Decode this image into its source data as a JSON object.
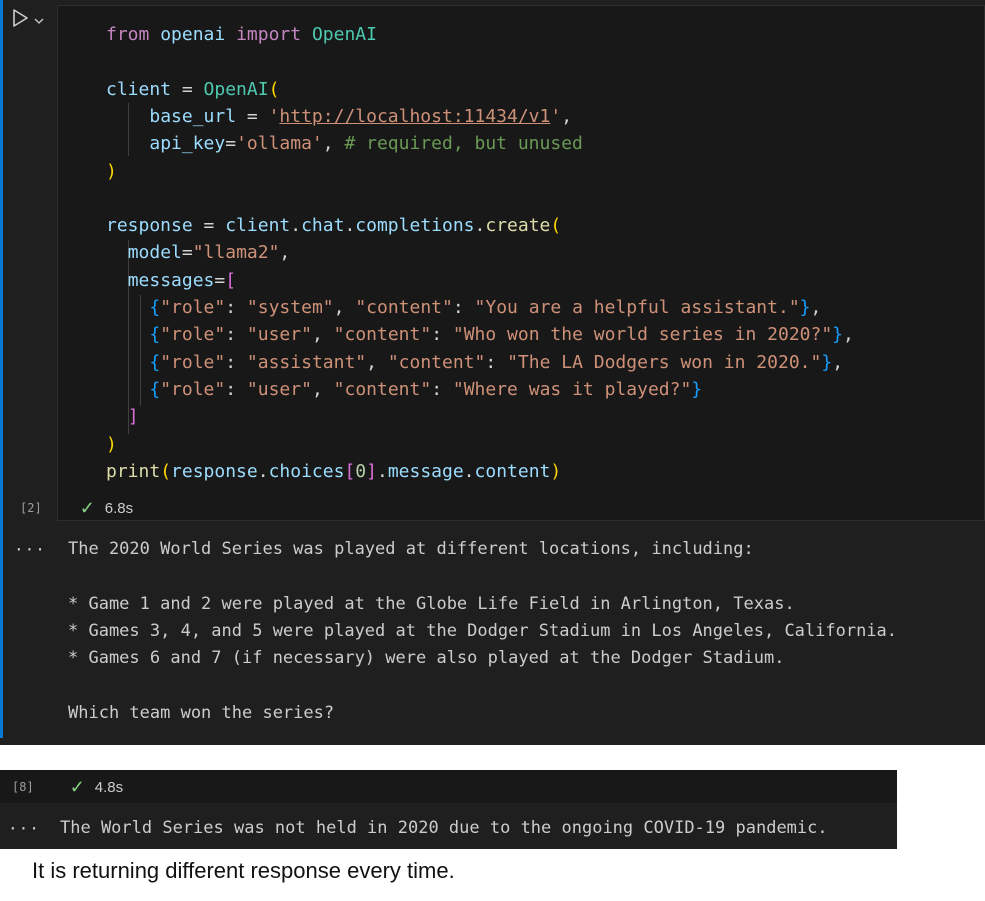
{
  "cell1": {
    "code_lines": [
      [
        [
          "kw",
          "from"
        ],
        [
          "op",
          " "
        ],
        [
          "var",
          "openai"
        ],
        [
          "op",
          " "
        ],
        [
          "kw",
          "import"
        ],
        [
          "op",
          " "
        ],
        [
          "cls",
          "OpenAI"
        ]
      ],
      [],
      [
        [
          "var",
          "client"
        ],
        [
          "op",
          " = "
        ],
        [
          "cls",
          "OpenAI"
        ],
        [
          "br1",
          "("
        ]
      ],
      [
        [
          "op",
          "    "
        ],
        [
          "var",
          "base_url"
        ],
        [
          "op",
          " = "
        ],
        [
          "str",
          "'"
        ],
        [
          "str url",
          "http://localhost:11434/v1"
        ],
        [
          "str",
          "'"
        ],
        [
          "op",
          ","
        ]
      ],
      [
        [
          "op",
          "    "
        ],
        [
          "var",
          "api_key"
        ],
        [
          "op",
          "="
        ],
        [
          "str",
          "'ollama'"
        ],
        [
          "op",
          ", "
        ],
        [
          "cmt",
          "# required, but unused"
        ]
      ],
      [
        [
          "br1",
          ")"
        ]
      ],
      [],
      [
        [
          "var",
          "response"
        ],
        [
          "op",
          " = "
        ],
        [
          "var",
          "client"
        ],
        [
          "op",
          "."
        ],
        [
          "var",
          "chat"
        ],
        [
          "op",
          "."
        ],
        [
          "var",
          "completions"
        ],
        [
          "op",
          "."
        ],
        [
          "fn",
          "create"
        ],
        [
          "br1",
          "("
        ]
      ],
      [
        [
          "op",
          "  "
        ],
        [
          "var",
          "model"
        ],
        [
          "op",
          "="
        ],
        [
          "str",
          "\"llama2\""
        ],
        [
          "op",
          ","
        ]
      ],
      [
        [
          "op",
          "  "
        ],
        [
          "var",
          "messages"
        ],
        [
          "op",
          "="
        ],
        [
          "br2",
          "["
        ]
      ],
      [
        [
          "op",
          "    "
        ],
        [
          "br3",
          "{"
        ],
        [
          "str",
          "\"role\""
        ],
        [
          "op",
          ": "
        ],
        [
          "str",
          "\"system\""
        ],
        [
          "op",
          ", "
        ],
        [
          "str",
          "\"content\""
        ],
        [
          "op",
          ": "
        ],
        [
          "str",
          "\"You are a helpful assistant.\""
        ],
        [
          "br3",
          "}"
        ],
        [
          "op",
          ","
        ]
      ],
      [
        [
          "op",
          "    "
        ],
        [
          "br3",
          "{"
        ],
        [
          "str",
          "\"role\""
        ],
        [
          "op",
          ": "
        ],
        [
          "str",
          "\"user\""
        ],
        [
          "op",
          ", "
        ],
        [
          "str",
          "\"content\""
        ],
        [
          "op",
          ": "
        ],
        [
          "str",
          "\"Who won the world series in 2020?\""
        ],
        [
          "br3",
          "}"
        ],
        [
          "op",
          ","
        ]
      ],
      [
        [
          "op",
          "    "
        ],
        [
          "br3",
          "{"
        ],
        [
          "str",
          "\"role\""
        ],
        [
          "op",
          ": "
        ],
        [
          "str",
          "\"assistant\""
        ],
        [
          "op",
          ", "
        ],
        [
          "str",
          "\"content\""
        ],
        [
          "op",
          ": "
        ],
        [
          "str",
          "\"The LA Dodgers won in 2020.\""
        ],
        [
          "br3",
          "}"
        ],
        [
          "op",
          ","
        ]
      ],
      [
        [
          "op",
          "    "
        ],
        [
          "br3",
          "{"
        ],
        [
          "str",
          "\"role\""
        ],
        [
          "op",
          ": "
        ],
        [
          "str",
          "\"user\""
        ],
        [
          "op",
          ", "
        ],
        [
          "str",
          "\"content\""
        ],
        [
          "op",
          ": "
        ],
        [
          "str",
          "\"Where was it played?\""
        ],
        [
          "br3",
          "}"
        ]
      ],
      [
        [
          "op",
          "  "
        ],
        [
          "br2",
          "]"
        ]
      ],
      [
        [
          "br1",
          ")"
        ]
      ],
      [
        [
          "fn",
          "print"
        ],
        [
          "br1",
          "("
        ],
        [
          "var",
          "response"
        ],
        [
          "op",
          "."
        ],
        [
          "var",
          "choices"
        ],
        [
          "br2",
          "["
        ],
        [
          "num",
          "0"
        ],
        [
          "br2",
          "]"
        ],
        [
          "op",
          "."
        ],
        [
          "var",
          "message"
        ],
        [
          "op",
          "."
        ],
        [
          "var",
          "content"
        ],
        [
          "br1",
          ")"
        ]
      ]
    ],
    "exec_count": "[2]",
    "exec_time": "6.8s",
    "output_ellipsis": "···",
    "output_lines": [
      "The 2020 World Series was played at different locations, including:",
      "",
      "* Game 1 and 2 were played at the Globe Life Field in Arlington, Texas.",
      "* Games 3, 4, and 5 were played at the Dodger Stadium in Los Angeles, California.",
      "* Games 6 and 7 (if necessary) were also played at the Dodger Stadium.",
      "",
      "Which team won the series?"
    ]
  },
  "cell2": {
    "exec_count": "[8]",
    "exec_time": "4.8s",
    "output_ellipsis": "···",
    "output_line": "The World Series was not held in 2020 due to the ongoing COVID-19 pandemic."
  },
  "caption": "It is returning different response every time.",
  "icons": {
    "run": "run-triangle-icon",
    "dropdown": "chevron-down-icon",
    "success": "checkmark-icon"
  },
  "colors": {
    "accent": "#0078d4",
    "success": "#89d185",
    "string": "#ce9178",
    "keyword": "#c586c0"
  }
}
